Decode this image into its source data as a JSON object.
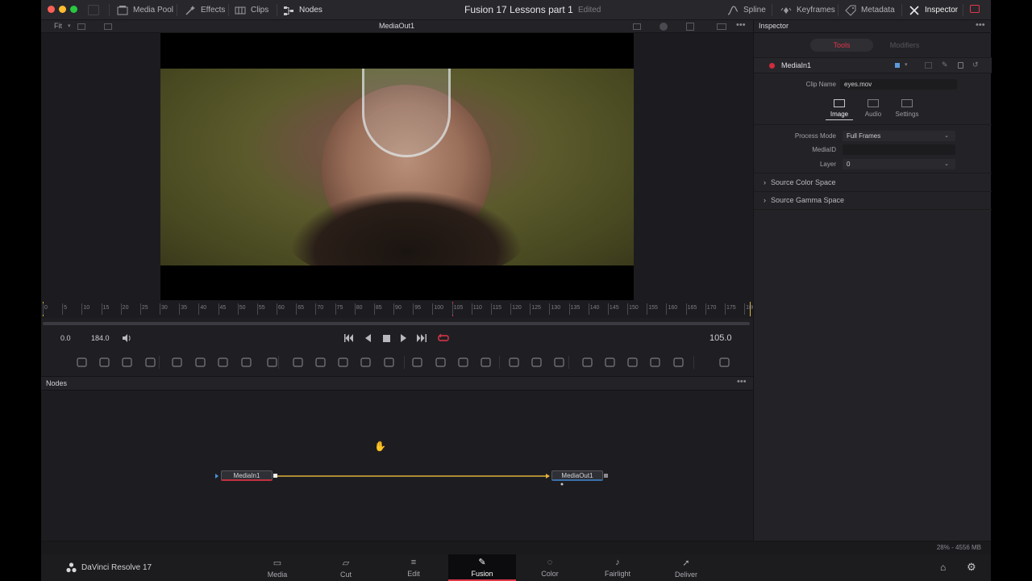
{
  "topbar": {
    "media_pool": "Media Pool",
    "effects": "Effects",
    "clips": "Clips",
    "nodes": "Nodes",
    "project_title": "Fusion 17  Lessons part 1",
    "edited": "Edited",
    "spline": "Spline",
    "keyframes": "Keyframes",
    "metadata": "Metadata",
    "inspector": "Inspector"
  },
  "viewer": {
    "zoom": "Fit",
    "label": "MediaOut1"
  },
  "timeline": {
    "ticks": [
      "0",
      "5",
      "10",
      "15",
      "20",
      "25",
      "30",
      "35",
      "40",
      "45",
      "50",
      "55",
      "60",
      "65",
      "70",
      "75",
      "80",
      "85",
      "90",
      "95",
      "100",
      "105",
      "110",
      "115",
      "120",
      "125",
      "130",
      "135",
      "140",
      "145",
      "150",
      "155",
      "160",
      "165",
      "170",
      "175",
      "180"
    ],
    "playhead": 105
  },
  "transport": {
    "start": "0.0",
    "end": "184.0",
    "current": "105.0"
  },
  "nodes_panel": {
    "title": "Nodes",
    "node_in": "MediaIn1",
    "node_out": "MediaOut1"
  },
  "inspector": {
    "title": "Inspector",
    "tab_tools": "Tools",
    "tab_modifiers": "Modifiers",
    "node_name": "MediaIn1",
    "clip_name_label": "Clip Name",
    "clip_name": "eyes.mov",
    "sub_tabs": [
      "Image",
      "Audio",
      "Settings"
    ],
    "process_mode_label": "Process Mode",
    "process_mode": "Full Frames",
    "media_id_label": "MediaID",
    "media_id": "",
    "layer_label": "Layer",
    "layer": "0",
    "section1": "Source Color Space",
    "section2": "Source Gamma Space"
  },
  "status": {
    "memory": "28% - 4556 MB"
  },
  "bottom": {
    "brand": "DaVinci Resolve 17",
    "pages": [
      "Media",
      "Cut",
      "Edit",
      "Fusion",
      "Color",
      "Fairlight",
      "Deliver"
    ],
    "active_page": "Fusion"
  },
  "colors": {
    "accent_red": "#e0364a",
    "connection": "#e0b23a",
    "panel": "#1f1f23"
  }
}
